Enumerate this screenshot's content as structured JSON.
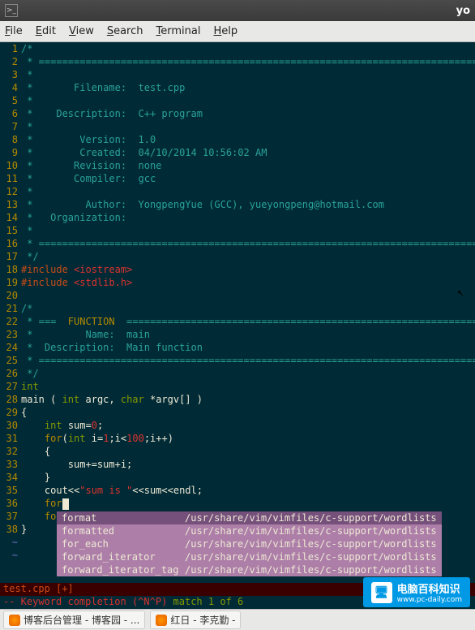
{
  "titlebar": {
    "title": "yo"
  },
  "menubar": {
    "file": "File",
    "edit": "Edit",
    "view": "View",
    "search": "Search",
    "terminal": "Terminal",
    "help": "Help"
  },
  "code": {
    "lines": [
      {
        "n": "1",
        "cls": "c-comment",
        "t": "/*"
      },
      {
        "n": "2",
        "cls": "c-comment",
        "t": " * ====================================================================================="
      },
      {
        "n": "3",
        "cls": "c-comment",
        "t": " *"
      },
      {
        "n": "4",
        "cls": "c-comment",
        "t": " *       Filename:  test.cpp"
      },
      {
        "n": "5",
        "cls": "c-comment",
        "t": " *"
      },
      {
        "n": "6",
        "cls": "c-comment",
        "t": " *    Description:  C++ program"
      },
      {
        "n": "7",
        "cls": "c-comment",
        "t": " *"
      },
      {
        "n": "8",
        "cls": "c-comment",
        "t": " *        Version:  1.0"
      },
      {
        "n": "9",
        "cls": "c-comment",
        "t": " *        Created:  04/10/2014 10:56:02 AM"
      },
      {
        "n": "10",
        "cls": "c-comment",
        "t": " *       Revision:  none"
      },
      {
        "n": "11",
        "cls": "c-comment",
        "t": " *       Compiler:  gcc"
      },
      {
        "n": "12",
        "cls": "c-comment",
        "t": " *"
      },
      {
        "n": "13",
        "cls": "c-comment",
        "t": " *         Author:  YongpengYue (GCC), yueyongpeng@hotmail.com"
      },
      {
        "n": "14",
        "cls": "c-comment",
        "t": " *   Organization:  "
      },
      {
        "n": "15",
        "cls": "c-comment",
        "t": " *"
      },
      {
        "n": "16",
        "cls": "c-comment",
        "t": " * ====================================================================================="
      },
      {
        "n": "17",
        "cls": "c-comment",
        "t": " */"
      }
    ],
    "inc1_a": "#include ",
    "inc1_b": "<iostream>",
    "inc2_a": "#include ",
    "inc2_b": "<stdlib.h>",
    "l20": "",
    "l21": "/*",
    "l22a": " * ===  ",
    "l22b": "FUNCTION",
    "l22c": "  ======================================================================",
    "l23": " *         Name:  main",
    "l24": " *  Description:  Main function",
    "l25": " * =====================================================================================",
    "l26": " */",
    "l27": "int",
    "l28a": "main ( ",
    "l28b": "int",
    "l28c": " argc, ",
    "l28d": "char",
    "l28e": " *argv[] )",
    "l29": "{",
    "l30a": "    ",
    "l30b": "int",
    "l30c": " sum=",
    "l30d": "0",
    "l30e": ";",
    "l31a": "    ",
    "l31b": "for",
    "l31c": "(",
    "l31d": "int",
    "l31e": " i=",
    "l31f": "1",
    "l31g": ";i<",
    "l31h": "100",
    "l31i": ";i++)",
    "l32": "    {",
    "l33": "        sum+=sum+i;",
    "l34": "    }",
    "l35a": "    cout<<",
    "l35b": "\"sum is \"",
    "l35c": "<<sum<<endl;",
    "l36a": "    ",
    "l36b": "for",
    "l37a": "    ",
    "l37b": "for",
    "l38": "}"
  },
  "popup": {
    "items": [
      {
        "word": "format",
        "path": "/usr/share/vim/vimfiles/c-support/wordlists"
      },
      {
        "word": "formatted",
        "path": "/usr/share/vim/vimfiles/c-support/wordlists"
      },
      {
        "word": "for_each",
        "path": "/usr/share/vim/vimfiles/c-support/wordlists"
      },
      {
        "word": "forward_iterator",
        "path": "/usr/share/vim/vimfiles/c-support/wordlists"
      },
      {
        "word": "forward_iterator_tag",
        "path": "/usr/share/vim/vimfiles/c-support/wordlists"
      }
    ]
  },
  "status": {
    "file": "test.cpp [+]",
    "mode": "-- Keyword completion (^N^P) ",
    "match": "match 1 of 6"
  },
  "taskbar": {
    "task1": "博客后台管理 - 博客园 - ...",
    "task2": "红日 - 李克勤 -"
  },
  "watermark": {
    "brand": "电脑百科知识",
    "url": "www.pc-daily.com"
  }
}
